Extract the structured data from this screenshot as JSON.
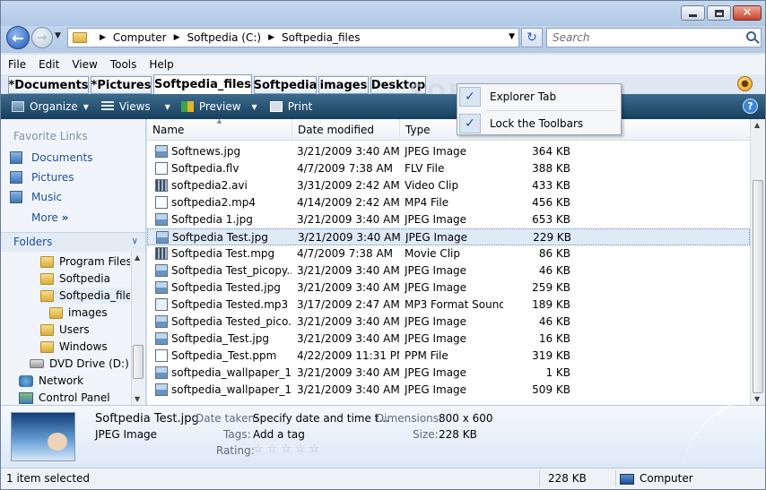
{
  "window": {
    "controls": {
      "minimize": "",
      "maximize": "",
      "close": "✕"
    }
  },
  "address": {
    "crumbs": [
      "Computer",
      "Softpedia (C:)",
      "Softpedia_files"
    ],
    "search_placeholder": "Search"
  },
  "menu": [
    "File",
    "Edit",
    "View",
    "Tools",
    "Help"
  ],
  "tabs": [
    "*Documents",
    "*Pictures",
    "Softpedia_files",
    "Softpedia",
    "images",
    "Desktop"
  ],
  "active_tab": "Softpedia_files",
  "toolbar": {
    "organize": "Organize",
    "views": "Views",
    "preview": "Preview",
    "print": "Print"
  },
  "context_menu": {
    "items": [
      {
        "label": "Explorer Tab",
        "checked": true
      },
      {
        "label": "Lock the Toolbars",
        "checked": true
      }
    ]
  },
  "nav": {
    "favorites_heading": "Favorite Links",
    "favorites": [
      "Documents",
      "Pictures",
      "Music"
    ],
    "more": "More",
    "folders_heading": "Folders",
    "tree": [
      {
        "label": "Program Files",
        "type": "folder",
        "indent": 2
      },
      {
        "label": "Softpedia",
        "type": "folder",
        "indent": 2
      },
      {
        "label": "Softpedia_files",
        "type": "folder",
        "indent": 2,
        "selected": true
      },
      {
        "label": "images",
        "type": "folder",
        "indent": 3
      },
      {
        "label": "Users",
        "type": "folder",
        "indent": 2
      },
      {
        "label": "Windows",
        "type": "folder",
        "indent": 2
      },
      {
        "label": "DVD Drive (D:)",
        "type": "drive",
        "indent": 1
      },
      {
        "label": "Network",
        "type": "net",
        "indent": 0
      },
      {
        "label": "Control Panel",
        "type": "cpanel",
        "indent": 0
      }
    ]
  },
  "columns": [
    "Name",
    "Date modified",
    "Type",
    "Size"
  ],
  "files": [
    {
      "name": "Softnews.jpg",
      "date": "3/21/2009 3:40 AM",
      "type": "JPEG Image",
      "size": "364 KB",
      "icon": "jpg"
    },
    {
      "name": "Softpedia.flv",
      "date": "4/7/2009 7:38 AM",
      "type": "FLV File",
      "size": "388 KB",
      "icon": "doc"
    },
    {
      "name": "softpedia2.avi",
      "date": "3/31/2009 2:42 AM",
      "type": "Video Clip",
      "size": "433 KB",
      "icon": "vid"
    },
    {
      "name": "softpedia2.mp4",
      "date": "4/14/2009 2:42 AM",
      "type": "MP4 File",
      "size": "456 KB",
      "icon": "doc"
    },
    {
      "name": "Softpedia 1.jpg",
      "date": "3/21/2009 3:40 AM",
      "type": "JPEG Image",
      "size": "653 KB",
      "icon": "jpg"
    },
    {
      "name": "Softpedia Test.jpg",
      "date": "3/21/2009 3:40 AM",
      "type": "JPEG Image",
      "size": "229 KB",
      "icon": "jpg",
      "selected": true
    },
    {
      "name": "Softpedia Test.mpg",
      "date": "4/7/2009 7:38 AM",
      "type": "Movie Clip",
      "size": "86 KB",
      "icon": "vid"
    },
    {
      "name": "Softpedia Test_picopy....",
      "date": "3/21/2009 3:40 AM",
      "type": "JPEG Image",
      "size": "46 KB",
      "icon": "jpg"
    },
    {
      "name": "Softpedia Tested.jpg",
      "date": "3/21/2009 3:40 AM",
      "type": "JPEG Image",
      "size": "259 KB",
      "icon": "jpg"
    },
    {
      "name": "Softpedia Tested.mp3",
      "date": "3/17/2009 2:47 AM",
      "type": "MP3 Format Sound",
      "size": "189 KB",
      "icon": "snd"
    },
    {
      "name": "Softpedia Tested_pico...",
      "date": "3/21/2009 3:40 AM",
      "type": "JPEG Image",
      "size": "46 KB",
      "icon": "jpg"
    },
    {
      "name": "Softpedia_Test.jpg",
      "date": "3/21/2009 3:40 AM",
      "type": "JPEG Image",
      "size": "16 KB",
      "icon": "jpg"
    },
    {
      "name": "Softpedia_Test.ppm",
      "date": "4/22/2009 11:31 PM",
      "type": "PPM File",
      "size": "319 KB",
      "icon": "doc"
    },
    {
      "name": "softpedia_wallpaper_1_...",
      "date": "3/21/2009 3:40 AM",
      "type": "JPEG Image",
      "size": "1 KB",
      "icon": "jpg"
    },
    {
      "name": "softpedia_wallpaper_1_...",
      "date": "3/21/2009 3:40 AM",
      "type": "JPEG Image",
      "size": "509 KB",
      "icon": "jpg"
    }
  ],
  "details": {
    "filename": "Softpedia Test.jpg",
    "filetype": "JPEG Image",
    "date_taken_label": "Date taken:",
    "date_taken_value": "Specify date and time t...",
    "tags_label": "Tags:",
    "tags_value": "Add a tag",
    "rating_label": "Rating:",
    "rating": 0,
    "dimensions_label": "Dimensions:",
    "dimensions_value": "800 x 600",
    "size_label": "Size:",
    "size_value": "228 KB"
  },
  "status": {
    "selection": "1 item selected",
    "size": "228 KB",
    "location": "Computer"
  },
  "watermark": "SOFTPEDIA"
}
